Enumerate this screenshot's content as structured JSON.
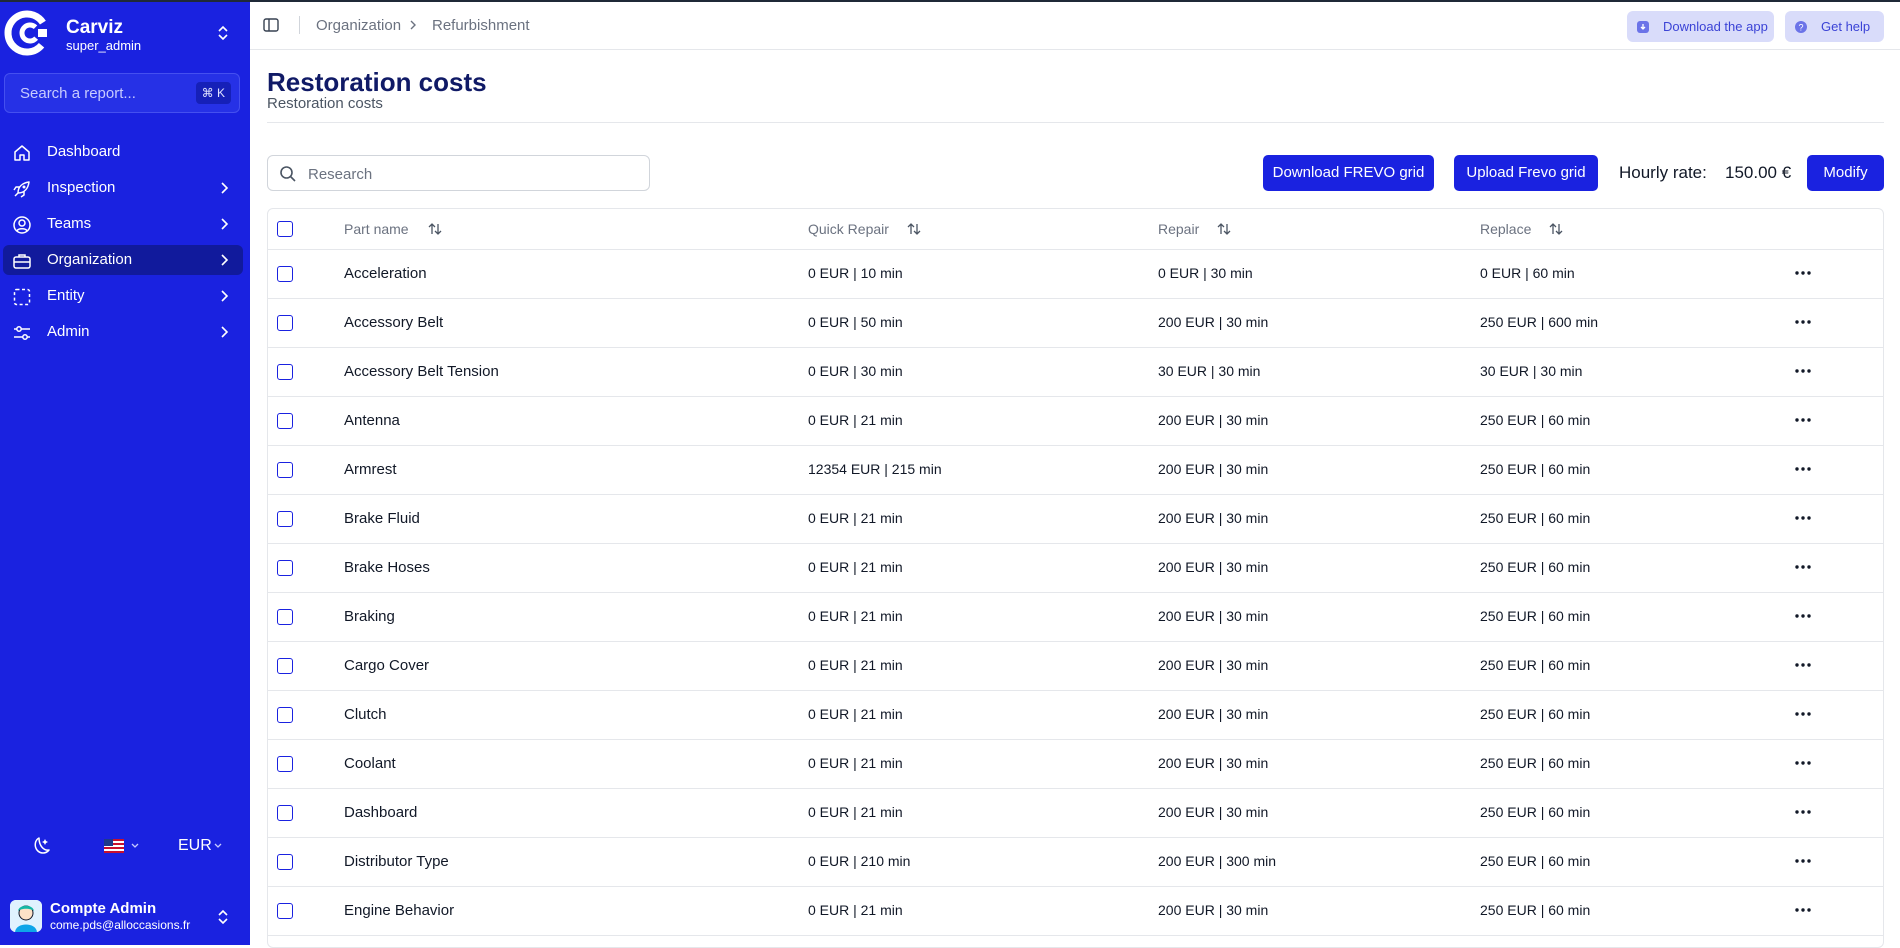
{
  "app": {
    "name": "Carviz",
    "role": "super_admin",
    "search_placeholder": "Search a report...",
    "search_shortcut": "⌘ K"
  },
  "sidebar": {
    "items": [
      {
        "label": "Dashboard",
        "icon": "home-icon",
        "has_chevron": false,
        "active": false
      },
      {
        "label": "Inspection",
        "icon": "rocket-icon",
        "has_chevron": true,
        "active": false
      },
      {
        "label": "Teams",
        "icon": "user-circle-icon",
        "has_chevron": true,
        "active": false
      },
      {
        "label": "Organization",
        "icon": "briefcase-icon",
        "has_chevron": true,
        "active": true
      },
      {
        "label": "Entity",
        "icon": "dashed-square-icon",
        "has_chevron": true,
        "active": false
      },
      {
        "label": "Admin",
        "icon": "sliders-icon",
        "has_chevron": true,
        "active": false
      }
    ],
    "currency": "EUR",
    "user": {
      "name": "Compte Admin",
      "email": "come.pds@alloccasions.fr"
    }
  },
  "header": {
    "breadcrumb": [
      "Organization",
      "Refurbishment"
    ],
    "download_app_label": "Download the app",
    "get_help_label": "Get help"
  },
  "page": {
    "title": "Restoration costs",
    "subtitle": "Restoration costs",
    "search_placeholder": "Research",
    "download_btn": "Download FREVO grid",
    "upload_btn": "Upload Frevo grid",
    "hourly_rate_label": "Hourly rate:",
    "hourly_rate_value": "150.00 €",
    "modify_btn": "Modify"
  },
  "table": {
    "columns": [
      "Part name",
      "Quick Repair",
      "Repair",
      "Replace"
    ],
    "rows": [
      {
        "part": "Acceleration",
        "quick": "0 EUR | 10 min",
        "repair": "0 EUR | 30 min",
        "replace": "0 EUR | 60 min"
      },
      {
        "part": "Accessory Belt",
        "quick": "0 EUR | 50 min",
        "repair": "200 EUR | 30 min",
        "replace": "250 EUR | 600 min"
      },
      {
        "part": "Accessory Belt Tension",
        "quick": "0 EUR | 30 min",
        "repair": "30 EUR | 30 min",
        "replace": "30 EUR | 30 min"
      },
      {
        "part": "Antenna",
        "quick": "0 EUR | 21 min",
        "repair": "200 EUR | 30 min",
        "replace": "250 EUR | 60 min"
      },
      {
        "part": "Armrest",
        "quick": "12354 EUR | 215 min",
        "repair": "200 EUR | 30 min",
        "replace": "250 EUR | 60 min"
      },
      {
        "part": "Brake Fluid",
        "quick": "0 EUR | 21 min",
        "repair": "200 EUR | 30 min",
        "replace": "250 EUR | 60 min"
      },
      {
        "part": "Brake Hoses",
        "quick": "0 EUR | 21 min",
        "repair": "200 EUR | 30 min",
        "replace": "250 EUR | 60 min"
      },
      {
        "part": "Braking",
        "quick": "0 EUR | 21 min",
        "repair": "200 EUR | 30 min",
        "replace": "250 EUR | 60 min"
      },
      {
        "part": "Cargo Cover",
        "quick": "0 EUR | 21 min",
        "repair": "200 EUR | 30 min",
        "replace": "250 EUR | 60 min"
      },
      {
        "part": "Clutch",
        "quick": "0 EUR | 21 min",
        "repair": "200 EUR | 30 min",
        "replace": "250 EUR | 60 min"
      },
      {
        "part": "Coolant",
        "quick": "0 EUR | 21 min",
        "repair": "200 EUR | 30 min",
        "replace": "250 EUR | 60 min"
      },
      {
        "part": "Dashboard",
        "quick": "0 EUR | 21 min",
        "repair": "200 EUR | 30 min",
        "replace": "250 EUR | 60 min"
      },
      {
        "part": "Distributor Type",
        "quick": "0 EUR | 210 min",
        "repair": "200 EUR | 300 min",
        "replace": "250 EUR | 60 min"
      },
      {
        "part": "Engine Behavior",
        "quick": "0 EUR | 21 min",
        "repair": "200 EUR | 30 min",
        "replace": "250 EUR | 60 min"
      }
    ]
  },
  "colors": {
    "brand": "#1a22e0",
    "sidebar_active": "#111a9c",
    "title": "#101a66"
  }
}
